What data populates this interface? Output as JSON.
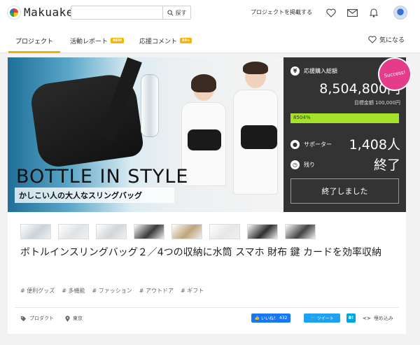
{
  "header": {
    "logo_text": "Makuake",
    "search_placeholder": "",
    "search_button": "探す",
    "publish_link": "プロジェクトを掲載する",
    "favorite_label": "気になる"
  },
  "tabs": [
    {
      "label": "プロジェクト",
      "badge": ""
    },
    {
      "label": "活動レポート",
      "badge": "NEW"
    },
    {
      "label": "応援コメント",
      "badge": "99+"
    }
  ],
  "hero": {
    "headline": "BOTTLE IN STYLE",
    "subline": "かしこい人の大人なスリングバッグ"
  },
  "stats": {
    "total_label": "応援購入総額",
    "total_value": "8,504,800円",
    "goal_text": "目標金額 100,000円",
    "progress_text": "8504%",
    "progress_fraction": 1.0,
    "supporters_label": "サポーター",
    "supporters_value": "1,408人",
    "remaining_label": "残り",
    "remaining_value": "終了",
    "success_badge": "Success!",
    "ended_button": "終了しました"
  },
  "thumbnails": [
    {
      "name": "thumb-1",
      "color": "#c9d3d8"
    },
    {
      "name": "thumb-2",
      "color": "#dfe3e6"
    },
    {
      "name": "thumb-3",
      "color": "#d2d6d9"
    },
    {
      "name": "thumb-4",
      "color": "#3a3a3a"
    },
    {
      "name": "thumb-5",
      "color": "#bfa57a"
    },
    {
      "name": "thumb-6",
      "color": "#e6e6e6"
    },
    {
      "name": "thumb-7",
      "color": "#2f2f2f"
    },
    {
      "name": "thumb-8",
      "color": "#444444"
    }
  ],
  "project": {
    "title": "ボトルインスリングバッグ２／4つの収納に水筒 スマホ 財布 鍵 カードを効率収納",
    "tags": [
      "# 便利グッズ",
      "# 多機能",
      "# ファッション",
      "# アウトドア",
      "# ギフト"
    ],
    "category": "プロダクト",
    "location": "東京",
    "like_label": "いいね！",
    "like_count": "432",
    "tweet_label": "ツイート",
    "hatena_label": "B!",
    "embed_label": "埋め込み"
  },
  "colors": {
    "accent": "#e8b400",
    "progress": "#a5e22c",
    "panel": "#333333",
    "success": "#e43c8a",
    "facebook": "#1877f2",
    "twitter": "#1da1f2",
    "hatena": "#00a4de"
  }
}
